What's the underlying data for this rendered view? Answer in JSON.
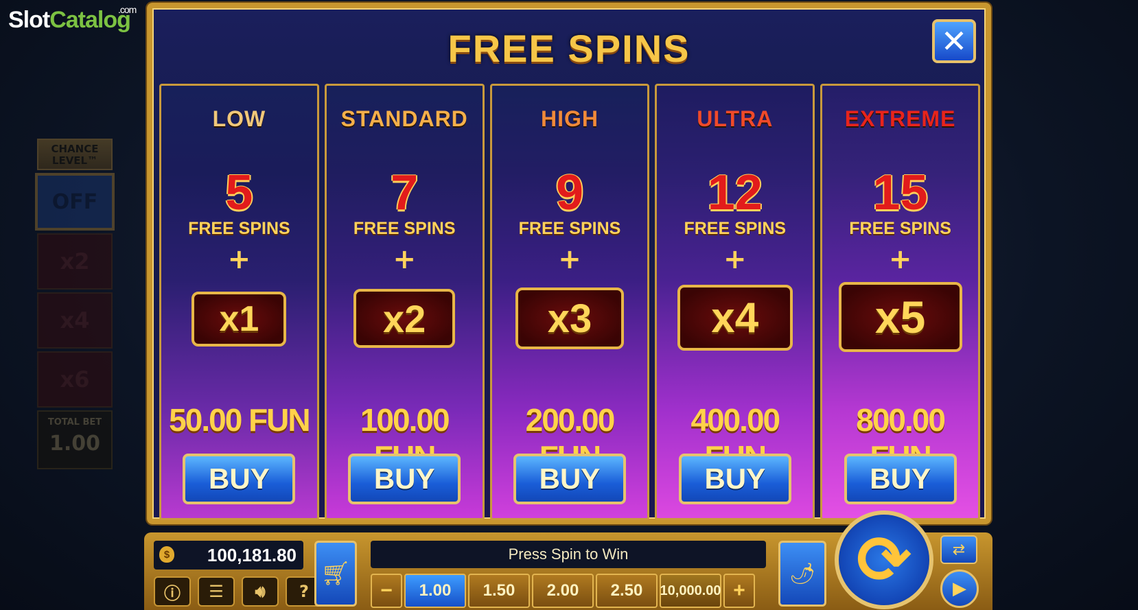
{
  "logo": {
    "part1": "Slot",
    "part2": "Catalog",
    "suffix": ".com"
  },
  "chance_panel": {
    "header": "CHANCE LEVEL™",
    "status": "OFF",
    "multipliers": [
      "x2",
      "x4",
      "x6"
    ],
    "total_bet_label": "TOTAL BET",
    "total_bet_value": "1.00"
  },
  "modal": {
    "title": "FREE SPINS",
    "close_icon": "close-icon"
  },
  "cards": [
    {
      "tier": "LOW",
      "tier_color": "#f0c87a",
      "spins": "5",
      "spins_label": "FREE SPINS",
      "plus": "+",
      "multiplier": "x1",
      "price": "50.00 FUN",
      "buy": "BUY"
    },
    {
      "tier": "STANDARD",
      "tier_color": "#f5b04a",
      "spins": "7",
      "spins_label": "FREE SPINS",
      "plus": "+",
      "multiplier": "x2",
      "price": "100.00 FUN",
      "buy": "BUY"
    },
    {
      "tier": "HIGH",
      "tier_color": "#f08a3a",
      "spins": "9",
      "spins_label": "FREE SPINS",
      "plus": "+",
      "multiplier": "x3",
      "price": "200.00 FUN",
      "buy": "BUY"
    },
    {
      "tier": "ULTRA",
      "tier_color": "#f04a2a",
      "spins": "12",
      "spins_label": "FREE SPINS",
      "plus": "+",
      "multiplier": "x4",
      "price": "400.00 FUN",
      "buy": "BUY"
    },
    {
      "tier": "EXTREME",
      "tier_color": "#e8241c",
      "spins": "15",
      "spins_label": "FREE SPINS",
      "plus": "+",
      "multiplier": "x5",
      "price": "800.00 FUN",
      "buy": "BUY"
    }
  ],
  "bottom_bar": {
    "balance": "100,181.80",
    "balance_icon": "money-bag-icon",
    "info_icon": "info-icon",
    "menu_icon": "menu-icon",
    "sound_icon": "sound-icon",
    "help_label": "?",
    "cart_icon": "shopping-cart-icon",
    "message": "Press Spin to Win",
    "bet_minus": "−",
    "bet_options": [
      "1.00",
      "1.50",
      "2.00",
      "2.50",
      "10,000.00"
    ],
    "bet_selected": "1.00",
    "bet_plus": "+",
    "chili_icon": "chili-icon",
    "spin_icon": "spin-icon",
    "autospin_icon": "autospin-icon",
    "turbo_icon": "play-icon"
  }
}
